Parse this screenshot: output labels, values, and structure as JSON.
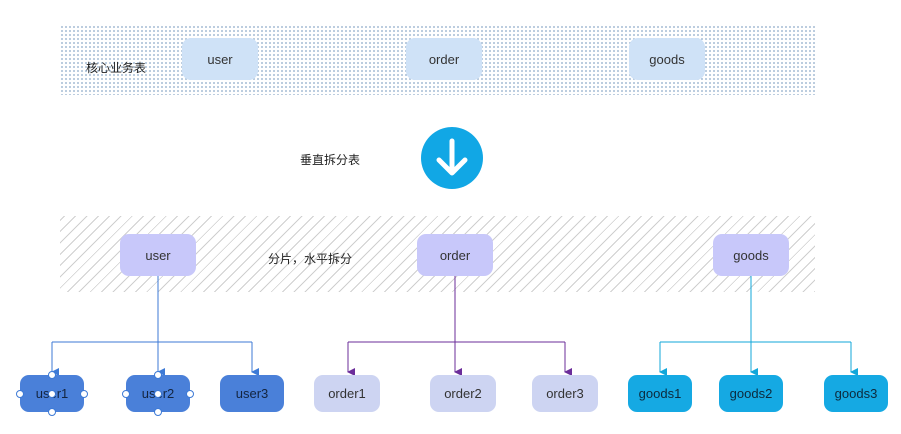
{
  "top_band": {
    "label": "核心业务表",
    "tables": [
      "user",
      "order",
      "goods"
    ]
  },
  "vertical_split_label": "垂直拆分表",
  "bottom_band": {
    "label": "分片，水平拆分",
    "tables": [
      "user",
      "order",
      "goods"
    ]
  },
  "shards": {
    "user": [
      "user1",
      "user2",
      "user3"
    ],
    "order": [
      "order1",
      "order2",
      "order3"
    ],
    "goods": [
      "goods1",
      "goods2",
      "goods3"
    ]
  },
  "colors": {
    "core_node": "#cfe2f7",
    "shard_parent": "#c8c8fa",
    "user_shard": "#4a80d9",
    "order_shard": "#cdd4f2",
    "goods_shard": "#15a9e3",
    "user_line": "#3d7ad6",
    "order_line": "#6b2d9a",
    "goods_line": "#12a7da",
    "arrow_circle": "#11a7e5"
  },
  "icons": [
    "arrow-down-icon"
  ]
}
